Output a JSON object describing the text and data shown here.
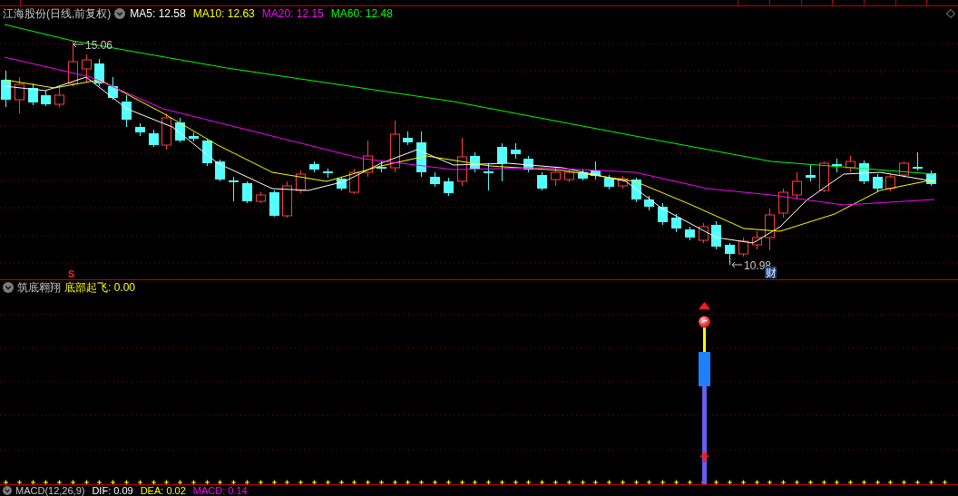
{
  "chart_header": {
    "title": "江海股份(日线,前复权)",
    "indicators": [
      {
        "label": "MA5: 12.58",
        "color": "#ffffff"
      },
      {
        "label": "MA10: 12.63",
        "color": "#ffff00"
      },
      {
        "label": "MA20: 12.15",
        "color": "#ff00ff"
      },
      {
        "label": "MA60: 12.48",
        "color": "#00ff00"
      }
    ]
  },
  "main_chart": {
    "high_label": "15.06",
    "low_label": "10.98",
    "sell_marker": "S",
    "finance_marker": "财"
  },
  "indicator_panel": {
    "title": "筑底翱翔",
    "reading": "底部起飞: 0.00"
  },
  "macd_panel": {
    "title": "MACD(12,26,9)",
    "readings": [
      {
        "label": "DIF: 0.09",
        "color": "#ffffff"
      },
      {
        "label": "DEA: 0.02",
        "color": "#ffff00"
      },
      {
        "label": "MACD: 0.14",
        "color": "#ff00ff"
      }
    ]
  }
}
